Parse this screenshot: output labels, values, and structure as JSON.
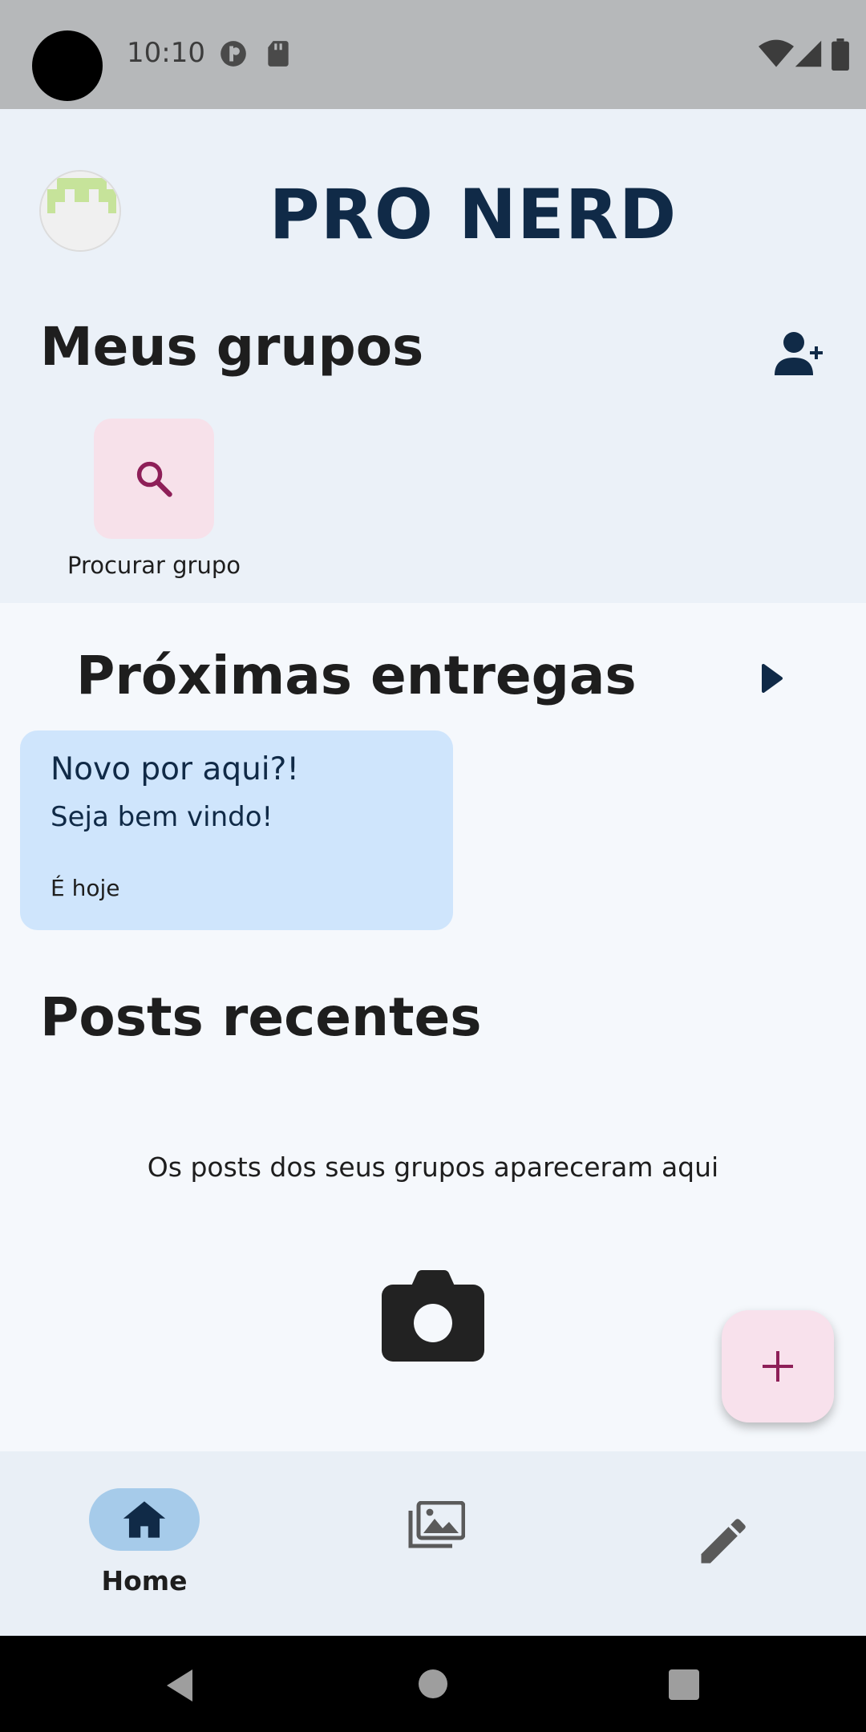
{
  "status_bar": {
    "time": "10:10"
  },
  "app": {
    "title": "PRO NERD"
  },
  "groups": {
    "title": "Meus grupos",
    "search_label": "Procurar grupo"
  },
  "deliveries": {
    "title": "Próximas entregas",
    "card": {
      "title": "Novo por aqui?!",
      "subtitle": "Seja bem vindo!",
      "date": "É hoje"
    }
  },
  "posts": {
    "title": "Posts recentes",
    "empty_message": "Os posts dos seus grupos apareceram aqui"
  },
  "bottom_nav": {
    "items": [
      {
        "label": "Home",
        "icon": "home-icon",
        "selected": true
      },
      {
        "label": "",
        "icon": "gallery-icon",
        "selected": false
      },
      {
        "label": "",
        "icon": "pencil-icon",
        "selected": false
      }
    ]
  },
  "colors": {
    "brand": "#102a47",
    "accent": "#8e1f58",
    "card": "#cfe5fc",
    "fab": "#f8e1ec"
  }
}
